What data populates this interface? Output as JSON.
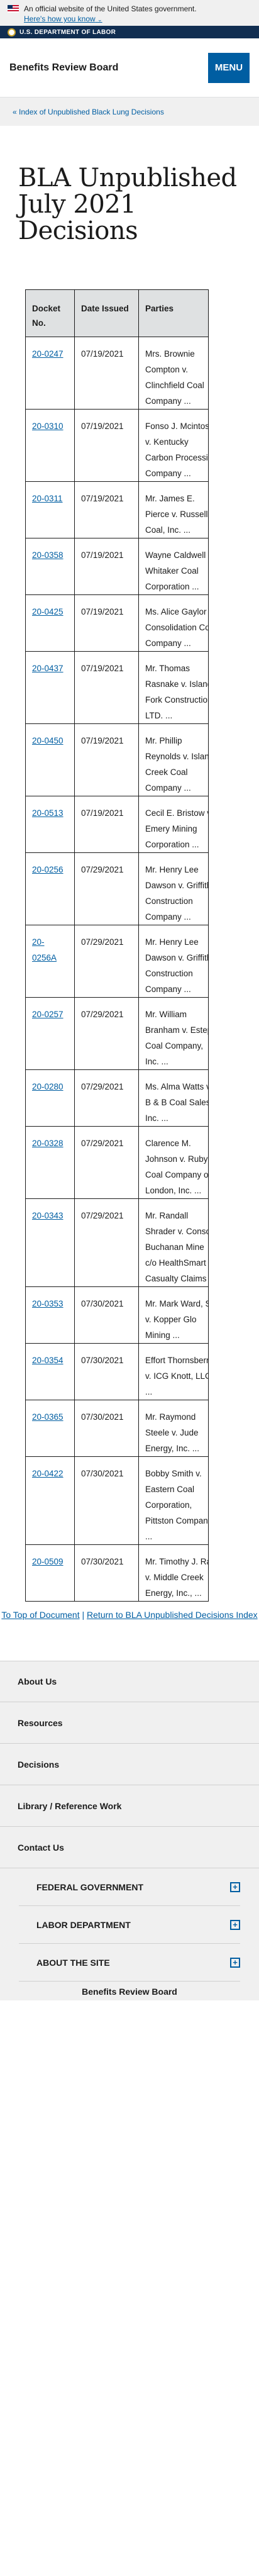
{
  "gov_banner": {
    "text": "An official website of the United States government.",
    "link": "Here's how you know"
  },
  "agency_bar": {
    "text": "U.S. DEPARTMENT OF LABOR"
  },
  "header": {
    "title": "Benefits Review Board",
    "menu_label": "MENU"
  },
  "breadcrumb": {
    "link": "« Index of Unpublished Black Lung Decisions"
  },
  "page": {
    "title": "BLA Unpublished July 2021 Decisions"
  },
  "table": {
    "headers": [
      "Docket No.",
      "Date Issued",
      "Parties"
    ],
    "rows": [
      {
        "docket": "20-0247",
        "date": "07/19/2021",
        "parties": "Mrs. Brownie Compton v. Clinchfield Coal Company ..."
      },
      {
        "docket": "20-0310",
        "date": "07/19/2021",
        "parties": "Fonso J. Mcintosh v. Kentucky Carbon Processing Company ..."
      },
      {
        "docket": "20-0311",
        "date": "07/19/2021",
        "parties": "Mr. James E. Pierce v. Russell Coal, Inc. ..."
      },
      {
        "docket": "20-0358",
        "date": "07/19/2021",
        "parties": "Wayne Caldwell v. Whitaker Coal Corporation ..."
      },
      {
        "docket": "20-0425",
        "date": "07/19/2021",
        "parties": "Ms. Alice Gaylor v. Consolidation Coal Company ..."
      },
      {
        "docket": "20-0437",
        "date": "07/19/2021",
        "parties": "Mr. Thomas Rasnake v. Island Fork Construction LTD. ..."
      },
      {
        "docket": "20-0450",
        "date": "07/19/2021",
        "parties": "Mr. Phillip Reynolds v. Island Creek Coal Company ..."
      },
      {
        "docket": "20-0513",
        "date": "07/19/2021",
        "parties": "Cecil E. Bristow v. Emery Mining Corporation ..."
      },
      {
        "docket": "20-0256",
        "date": "07/29/2021",
        "parties": "Mr. Henry Lee Dawson v. Griffith Construction Company ..."
      },
      {
        "docket": "20-0256A",
        "date": "07/29/2021",
        "parties": "Mr. Henry Lee Dawson v. Griffith Construction Company ..."
      },
      {
        "docket": "20-0257",
        "date": "07/29/2021",
        "parties": "Mr. William Branham v. Estep Coal Company, Inc. ..."
      },
      {
        "docket": "20-0280",
        "date": "07/29/2021",
        "parties": "Ms. Alma Watts v. B & B Coal Sales, Inc. ..."
      },
      {
        "docket": "20-0328",
        "date": "07/29/2021",
        "parties": "Clarence M. Johnson v. Ruby Coal Company of London, Inc. ..."
      },
      {
        "docket": "20-0343",
        "date": "07/29/2021",
        "parties": "Mr. Randall Shrader v. Consol Buchanan Mine c/o HealthSmart Casualty Claims ..."
      },
      {
        "docket": "20-0353",
        "date": "07/30/2021",
        "parties": "Mr. Mark Ward, Sr. v. Kopper Glo Mining ..."
      },
      {
        "docket": "20-0354",
        "date": "07/30/2021",
        "parties": "Effort Thornsberry v. ICG Knott, LLC ..."
      },
      {
        "docket": "20-0365",
        "date": "07/30/2021",
        "parties": "Mr. Raymond Steele v. Jude Energy, Inc. ..."
      },
      {
        "docket": "20-0422",
        "date": "07/30/2021",
        "parties": "Bobby Smith v. Eastern Coal Corporation, Pittston Company ..."
      },
      {
        "docket": "20-0509",
        "date": "07/30/2021",
        "parties": "Mr. Timothy J. Ray v. Middle Creek Energy, Inc., ..."
      }
    ]
  },
  "bottom_links": {
    "top": "To Top of Document",
    "separator": "|",
    "index": "Return to BLA Unpublished Decisions Index"
  },
  "footer_nav": [
    "About Us",
    "Resources",
    "Decisions",
    "Library / Reference Work",
    "Contact Us"
  ],
  "footer_accordion": [
    "FEDERAL GOVERNMENT",
    "LABOR DEPARTMENT",
    "ABOUT THE SITE"
  ],
  "footer_bottom": {
    "text": "Benefits Review Board"
  },
  "colors": {
    "link": "#005ea2",
    "agency_bar": "#112e51",
    "header_cell": "#dfe1e2"
  }
}
